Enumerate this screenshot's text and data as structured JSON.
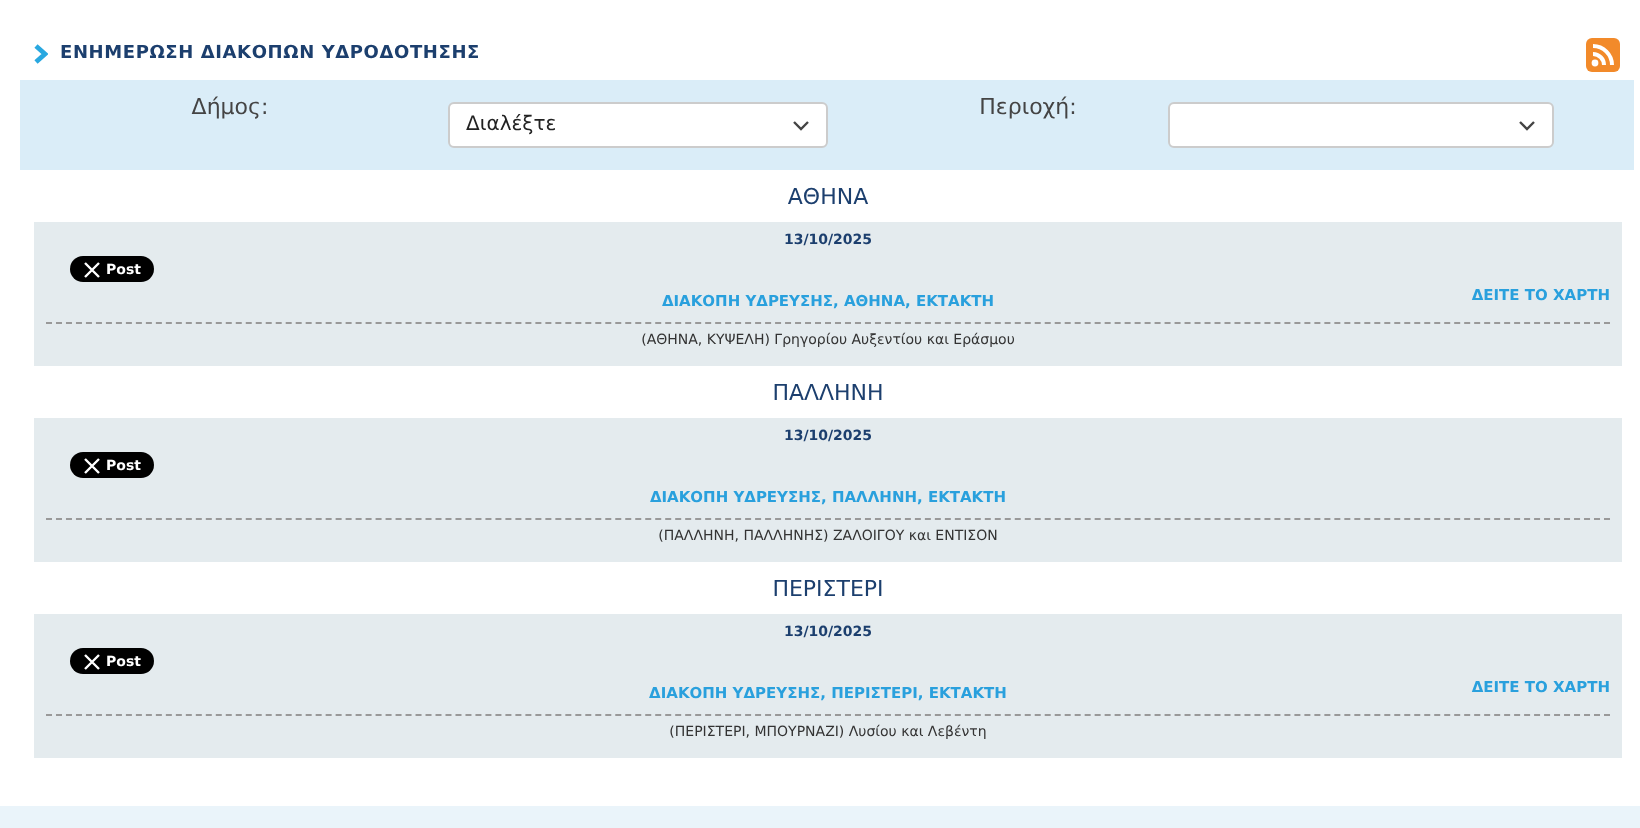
{
  "title": "ΕΝΗΜΕΡΩΣΗ ΔΙΑΚΟΠΩΝ ΥΔΡΟΔΟΤΗΣΗΣ",
  "filters": [
    {
      "label": "Δήμος:",
      "value": "Διαλέξτε"
    },
    {
      "label": "Περιοχή:"
    }
  ],
  "sections": [
    {
      "heading": "ΑΘΗΝΑ",
      "date": "13/10/2025",
      "share": "Post",
      "title": "ΔΙΑΚΟΠΗ ΥΔΡΕΥΣΗΣ, ΑΘΗΝΑ, ΕΚΤΑΚΤΗ",
      "map_link": "ΔΕΙΤΕ ΤΟ ΧΑΡΤΗ",
      "details": "(ΑΘΗΝΑ, ΚΥΨΕΛΗ) Γρηγορίου Αυξεντίου και Εράσμου"
    },
    {
      "heading": "ΠΑΛΛΗΝΗ",
      "date": "13/10/2025",
      "share": "Post",
      "title": "ΔΙΑΚΟΠΗ ΥΔΡΕΥΣΗΣ, ΠΑΛΛΗΝΗ, ΕΚΤΑΚΤΗ",
      "details": "(ΠΑΛΛΗΝΗ, ΠΑΛΛΗΝΗΣ) ΖΑΛΟΙΓΟΥ και ΕΝΤΙΣΟΝ"
    },
    {
      "heading": "ΠΕΡΙΣΤΕΡΙ",
      "date": "13/10/2025",
      "share": "Post",
      "title": "ΔΙΑΚΟΠΗ ΥΔΡΕΥΣΗΣ, ΠΕΡΙΣΤΕΡΙ, ΕΚΤΑΚΤΗ",
      "map_link": "ΔΕΙΤΕ ΤΟ ΧΑΡΤΗ",
      "details": "(ΠΕΡΙΣΤΕΡΙ, ΜΠΟΥΡΝΑΖΙ) Λυσίου και Λεβέντη"
    }
  ]
}
